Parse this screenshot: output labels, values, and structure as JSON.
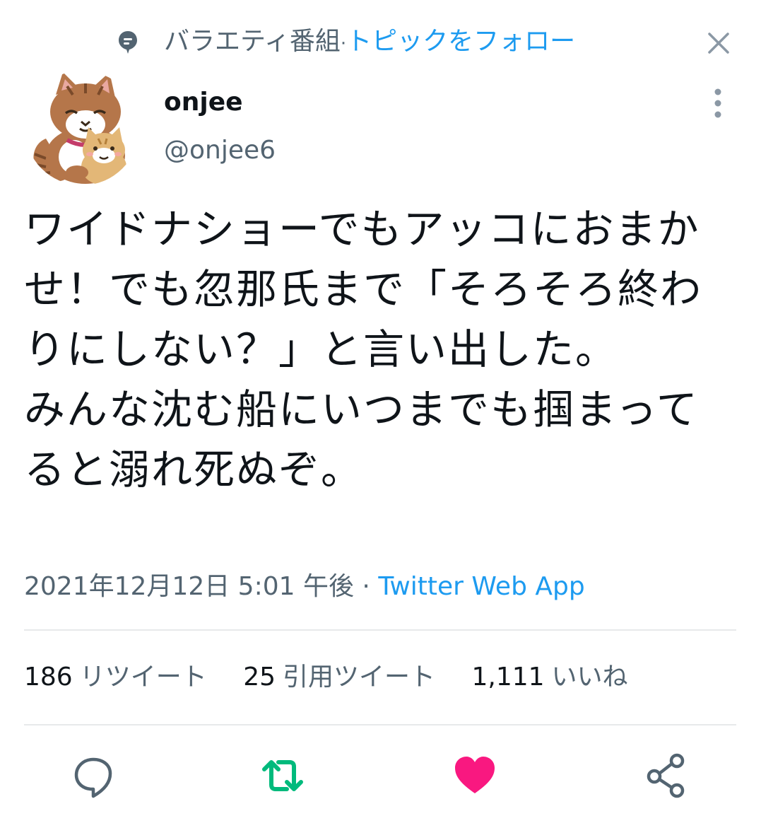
{
  "topic": {
    "name": "バラエティ番組",
    "separator": "·",
    "follow_label": "トピックをフォロー"
  },
  "author": {
    "display_name": "onjee",
    "handle": "@onjee6"
  },
  "tweet": {
    "text": "ワイドナショーでもアッコにおまかせ！でも忽那氏まで「そろそろ終わりにしない？」と言い出した。\nみんな沈む船にいつまでも掴まってると溺れ死ぬぞ。"
  },
  "meta": {
    "timestamp": "2021年12月12日 5:01 午後",
    "separator": "·",
    "source": "Twitter Web App"
  },
  "stats": {
    "retweets": {
      "count": "186",
      "label": "リツイート"
    },
    "quotes": {
      "count": "25",
      "label": "引用ツイート"
    },
    "likes": {
      "count": "1,111",
      "label": "いいね"
    }
  },
  "actions": {
    "reply_icon": "reply-icon",
    "retweet_icon": "retweet-icon",
    "like_icon": "heart-icon",
    "share_icon": "share-icon"
  },
  "colors": {
    "accent": "#1d9bf0",
    "secondary_text": "#536471",
    "retweet_green": "#00ba7c",
    "like_pink": "#f91880",
    "divider": "#e7e9ea"
  }
}
